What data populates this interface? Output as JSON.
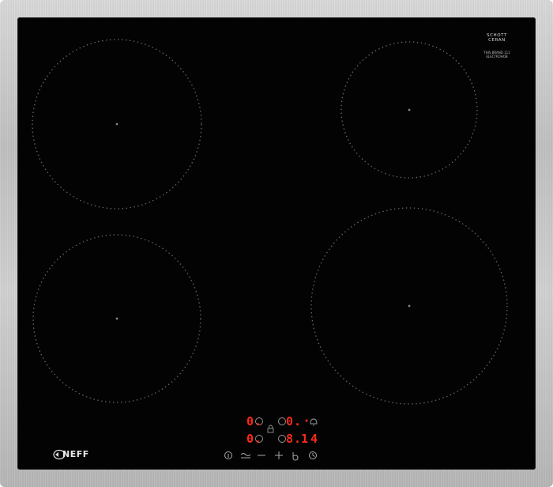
{
  "appliance": {
    "brand": "NEFF",
    "glass_maker": "SCHOTT CERAN",
    "glass_sub": "THIS BRAND 111 ELECTROHOB"
  },
  "displays": {
    "zone_top_left_level": "0.",
    "zone_top_right_level": "0.",
    "zone_bottom_left_level": "0.",
    "zone_bottom_right_level": "8.",
    "timer": "14"
  },
  "icons": {
    "info": "info-icon",
    "wipe": "wipe-protection-icon",
    "minus": "minus-icon",
    "plus": "plus-icon",
    "power": "power-icon",
    "timer": "timer-icon",
    "alarm": "alarm-bell-icon",
    "lock": "lock-icon"
  },
  "colors": {
    "glass": "#030303",
    "frame": "#c7c7c7",
    "display_red": "#ff2a1a",
    "zone_markers": "#6a6a6a"
  }
}
